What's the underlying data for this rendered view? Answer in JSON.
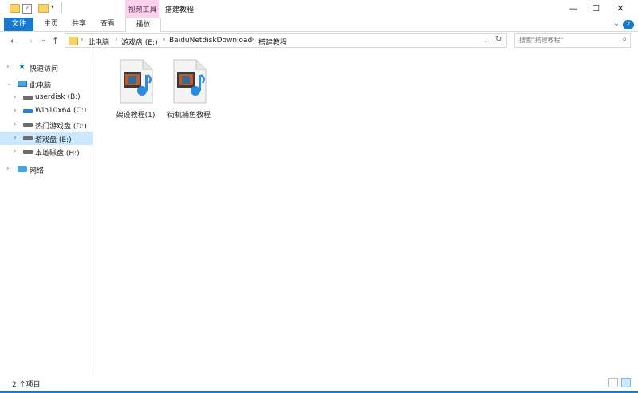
{
  "window": {
    "title": "搭建教程",
    "context_tab_group": "视频工具",
    "minimize": "—",
    "maximize": "☐",
    "close": "✕"
  },
  "ribbon": {
    "tabs": [
      "文件",
      "主页",
      "共享",
      "查看",
      "播放"
    ],
    "help": "?",
    "expand": "⌄"
  },
  "address": {
    "back": "←",
    "forward": "→",
    "recent": "⌄",
    "up": "↑",
    "path": [
      "此电脑",
      "游戏盘 (E:)",
      "BaiduNetdiskDownload",
      "搭建教程"
    ],
    "dropdown": "⌄",
    "refresh": "↻"
  },
  "search": {
    "placeholder": "搜索\"搭建教程\""
  },
  "nav": {
    "quick_access": "快速访问",
    "this_pc": "此电脑",
    "drives": [
      "userdisk (B:)",
      "Win10x64 (C:)",
      "热门游戏盘 (D:)",
      "游戏盘 (E:)",
      "本地磁盘 (H:)"
    ],
    "network": "网络"
  },
  "files": [
    {
      "name": "架设教程(1)"
    },
    {
      "name": "街机捕鱼教程"
    }
  ],
  "status": {
    "count": "2 个项目"
  },
  "colors": {
    "accent": "#1979ca",
    "context_tab": "#f9d3ec",
    "selection": "#cce8ff"
  }
}
